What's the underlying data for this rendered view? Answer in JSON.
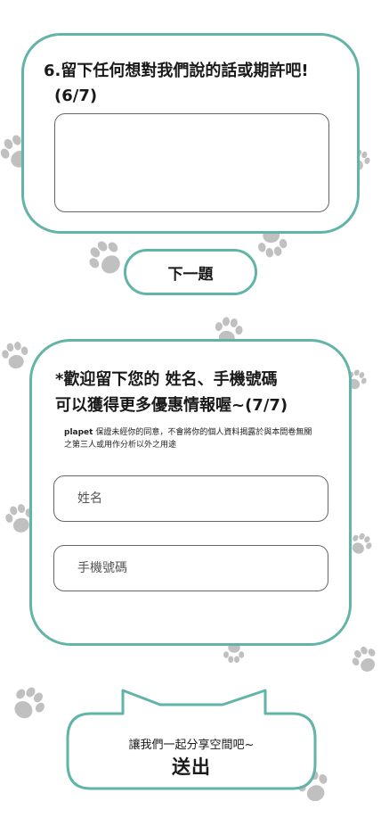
{
  "colors": {
    "accent": "#62b3a8",
    "paw": "#8d8d8d",
    "text": "#1a1a1a"
  },
  "question6": {
    "title": "6.留下任何想對我們說的話或期許吧!",
    "progress": "(6/7)",
    "textarea_value": ""
  },
  "next_button": {
    "label": "下一題"
  },
  "question7": {
    "title_line1": "*歡迎留下您的 姓名、手機號碼",
    "title_line2": "可以獲得更多優惠情報喔~(7/7)",
    "privacy_brand": "plapet",
    "privacy_text": " 保證未經你的同意，不會將你的個人資料揭露於與本問卷無關之第三人或用作分析以外之用途",
    "name_placeholder": "姓名",
    "phone_placeholder": "手機號碼"
  },
  "submit": {
    "subtitle": "讓我們一起分享空間吧~",
    "label": "送出"
  },
  "decor": {
    "paw_icon": "paw-print-icon"
  }
}
